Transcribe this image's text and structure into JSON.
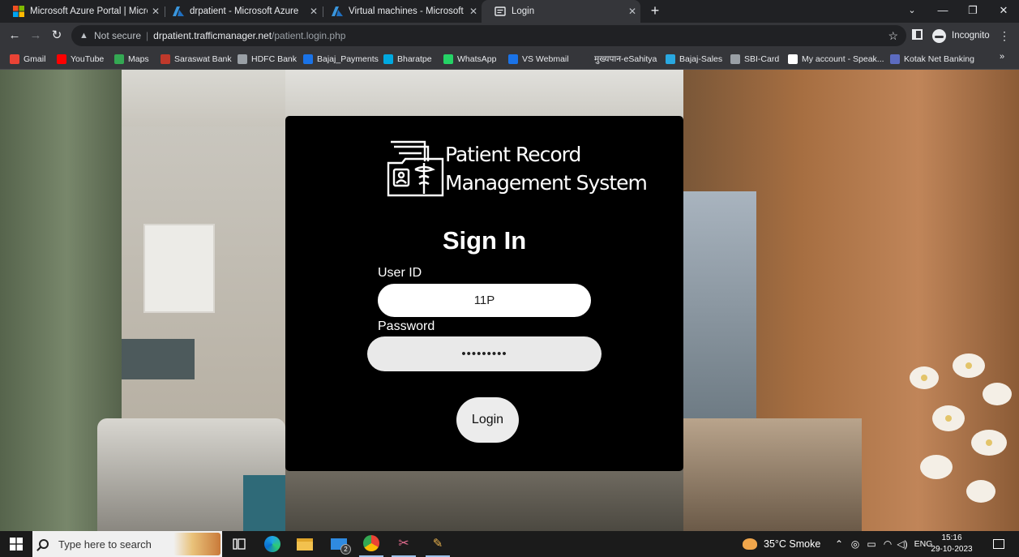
{
  "browser": {
    "tabs": [
      {
        "title": "Microsoft Azure Portal | Microso",
        "icon": "microsoft-icon",
        "active": false
      },
      {
        "title": "drpatient - Microsoft Azure",
        "icon": "azure-icon",
        "active": false
      },
      {
        "title": "Virtual machines - Microsoft Azu",
        "icon": "azure-icon",
        "active": false
      },
      {
        "title": "Login",
        "icon": "page-icon",
        "active": true
      }
    ],
    "new_tab": "+",
    "address": {
      "security": "Not secure",
      "host": "drpatient.trafficmanager.net",
      "path": "/patient.login.php"
    },
    "profile": "Incognito",
    "bookmarks": [
      {
        "label": "Gmail",
        "color": "#ea4335"
      },
      {
        "label": "YouTube",
        "color": "#ff0000"
      },
      {
        "label": "Maps",
        "color": "#34a853"
      },
      {
        "label": "Saraswat Bank",
        "color": "#c0392b"
      },
      {
        "label": "HDFC Bank",
        "color": "#9aa0a6"
      },
      {
        "label": "Bajaj_Payments",
        "color": "#1a73e8"
      },
      {
        "label": "Bharatpe",
        "color": "#00a9e0"
      },
      {
        "label": "WhatsApp",
        "color": "#25d366"
      },
      {
        "label": "VS Webmail",
        "color": "#1a73e8"
      },
      {
        "label": "मुख्यपान-eSahitya",
        "color": "#35363a"
      },
      {
        "label": "Bajaj-Sales",
        "color": "#29a8e0"
      },
      {
        "label": "SBI-Card",
        "color": "#9aa0a6"
      },
      {
        "label": "My account - Speak...",
        "color": "#ffffff"
      },
      {
        "label": "Kotak Net Banking",
        "color": "#5c6bc0"
      }
    ]
  },
  "login": {
    "logo_line1": "Patient Record",
    "logo_line2": "Management System",
    "heading": "Sign In",
    "user_label": "User ID",
    "user_value": "11P",
    "password_label": "Password",
    "password_value": "•••••••••",
    "button_label": "Login"
  },
  "taskbar": {
    "search_placeholder": "Type here to search",
    "weather": "35°C  Smoke",
    "language": "ENG",
    "time": "15:16",
    "date": "29-10-2023",
    "mail_badge": "2"
  }
}
